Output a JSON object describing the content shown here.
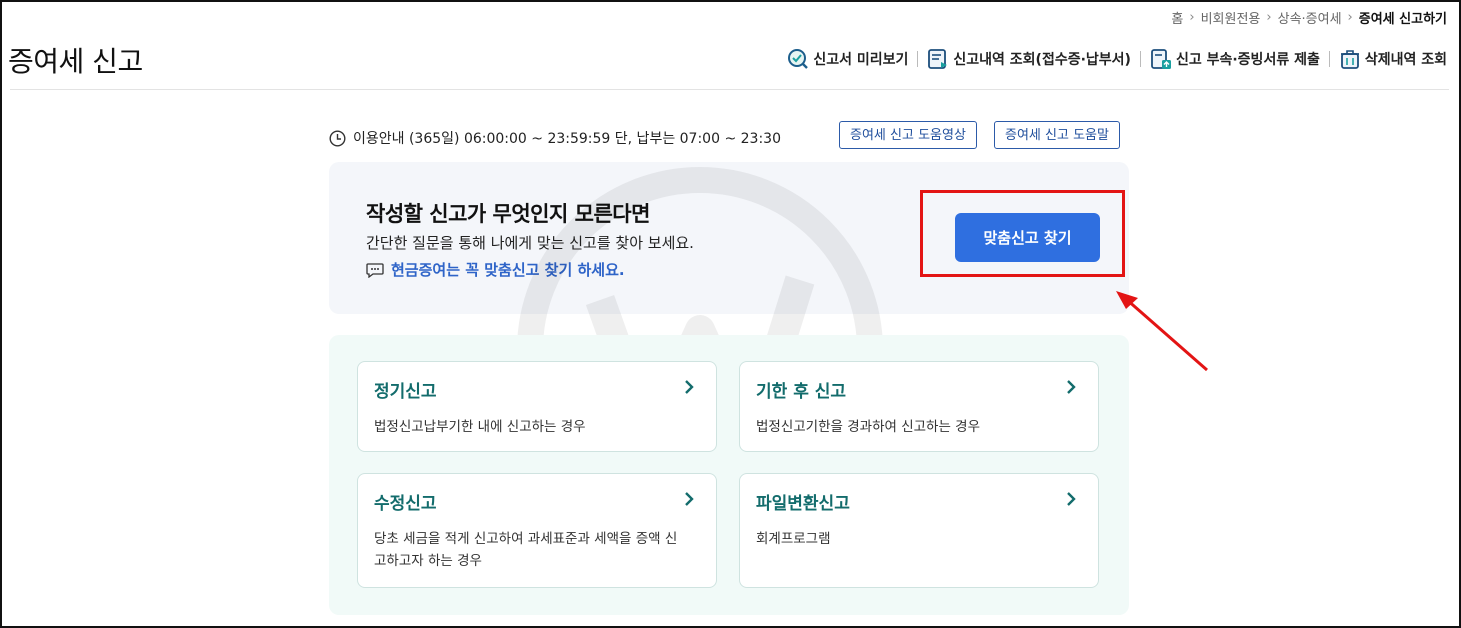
{
  "breadcrumb": {
    "items": [
      "홈",
      "비회원전용",
      "상속·증여세"
    ],
    "current": "증여세 신고하기"
  },
  "page": {
    "title": "증여세 신고"
  },
  "toolbar": {
    "preview": "신고서 미리보기",
    "history": "신고내역 조회(접수증·납부서)",
    "attach": "신고 부속·증빙서류 제출",
    "deleted": "삭제내역 조회"
  },
  "info": {
    "hours": "이용안내 (365일) 06:00:00 ~ 23:59:59 단, 납부는 07:00 ~ 23:30",
    "help_video": "증여세 신고 도움영상",
    "help_text": "증여세 신고 도움말"
  },
  "hero": {
    "title": "작성할 신고가 무엇인지 모른다면",
    "desc": "간단한 질문을 통해 나에게 맞는 신고를 찾아 보세요.",
    "note": "현금증여는 꼭 맞춤신고 찾기 하세요.",
    "cta": "맞춤신고 찾기"
  },
  "cards": [
    {
      "title": "정기신고",
      "desc": "법정신고납부기한 내에 신고하는 경우"
    },
    {
      "title": "기한 후 신고",
      "desc": "법정신고기한을 경과하여 신고하는 경우"
    },
    {
      "title": "수정신고",
      "desc": "당초 세금을 적게 신고하여 과세표준과 세액을 증액 신고하고자 하는 경우"
    },
    {
      "title": "파일변환신고",
      "desc": "회계프로그램"
    }
  ],
  "colors": {
    "accent": "#2f6fe0",
    "card_title": "#136c6c",
    "annotation": "#e31414"
  }
}
